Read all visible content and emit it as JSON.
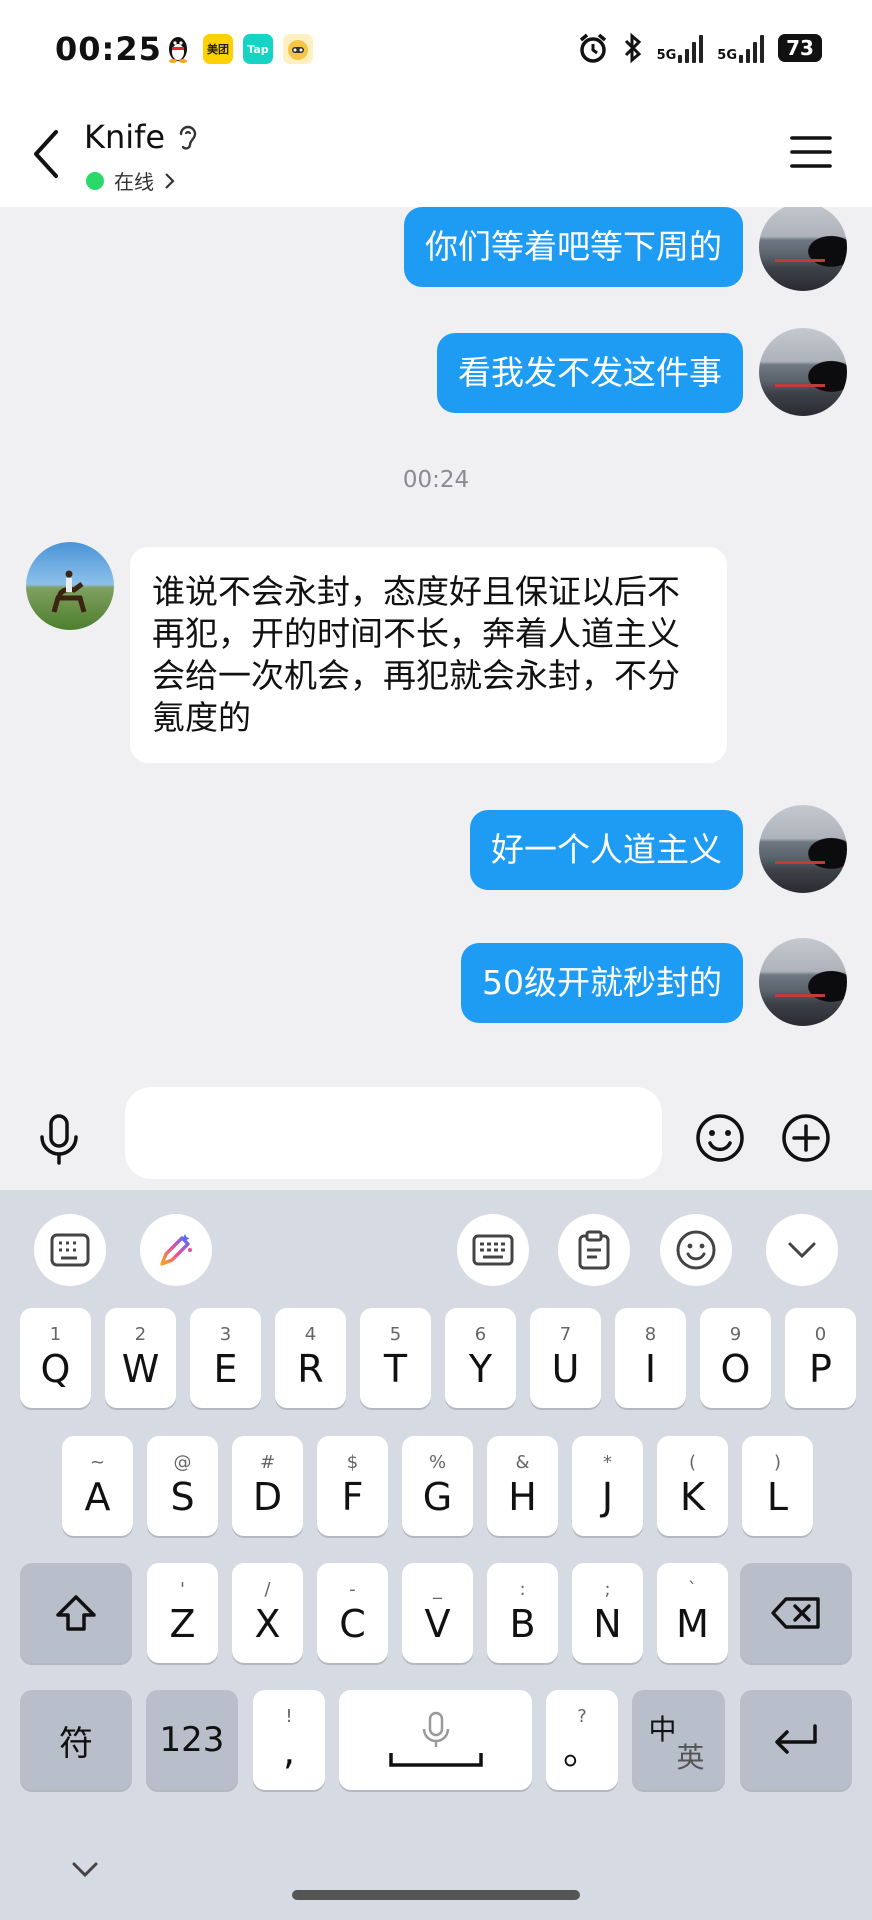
{
  "status_bar": {
    "time": "00:25",
    "app_badges": [
      "美团",
      "Tap"
    ],
    "network_1": "5G",
    "network_2": "5G",
    "battery": "73"
  },
  "header": {
    "contact_name": "Knife",
    "status_text": "在线"
  },
  "messages": [
    {
      "side": "out",
      "text": "你们等着吧等下周的"
    },
    {
      "side": "out",
      "text": "看我发不发这件事"
    },
    {
      "side": "time",
      "text": "00:24"
    },
    {
      "side": "in",
      "text": "谁说不会永封，态度好且保证以后不再犯，开的时间不长，奔着人道主义会给一次机会，再犯就会永封，不分氪度的"
    },
    {
      "side": "out",
      "text": "好一个人道主义"
    },
    {
      "side": "out",
      "text": "50级开就秒封的"
    }
  ],
  "input": {
    "value": "",
    "placeholder": ""
  },
  "keyboard": {
    "row1": [
      {
        "hint": "1",
        "label": "Q"
      },
      {
        "hint": "2",
        "label": "W"
      },
      {
        "hint": "3",
        "label": "E"
      },
      {
        "hint": "4",
        "label": "R"
      },
      {
        "hint": "5",
        "label": "T"
      },
      {
        "hint": "6",
        "label": "Y"
      },
      {
        "hint": "7",
        "label": "U"
      },
      {
        "hint": "8",
        "label": "I"
      },
      {
        "hint": "9",
        "label": "O"
      },
      {
        "hint": "0",
        "label": "P"
      }
    ],
    "row2": [
      {
        "hint": "~",
        "label": "A"
      },
      {
        "hint": "@",
        "label": "S"
      },
      {
        "hint": "#",
        "label": "D"
      },
      {
        "hint": "$",
        "label": "F"
      },
      {
        "hint": "%",
        "label": "G"
      },
      {
        "hint": "&",
        "label": "H"
      },
      {
        "hint": "*",
        "label": "J"
      },
      {
        "hint": "(",
        "label": "K"
      },
      {
        "hint": ")",
        "label": "L"
      }
    ],
    "row3": [
      {
        "hint": "'",
        "label": "Z"
      },
      {
        "hint": "/",
        "label": "X"
      },
      {
        "hint": "-",
        "label": "C"
      },
      {
        "hint": "_",
        "label": "V"
      },
      {
        "hint": ":",
        "label": "B"
      },
      {
        "hint": ";",
        "label": "N"
      },
      {
        "hint": "`",
        "label": "M"
      }
    ],
    "symbols_label": "符",
    "numbers_label": "123",
    "comma_hint": "!",
    "comma_label": ",",
    "period_hint": "?",
    "period_label": "。",
    "lang_primary": "中",
    "lang_secondary": "英"
  }
}
